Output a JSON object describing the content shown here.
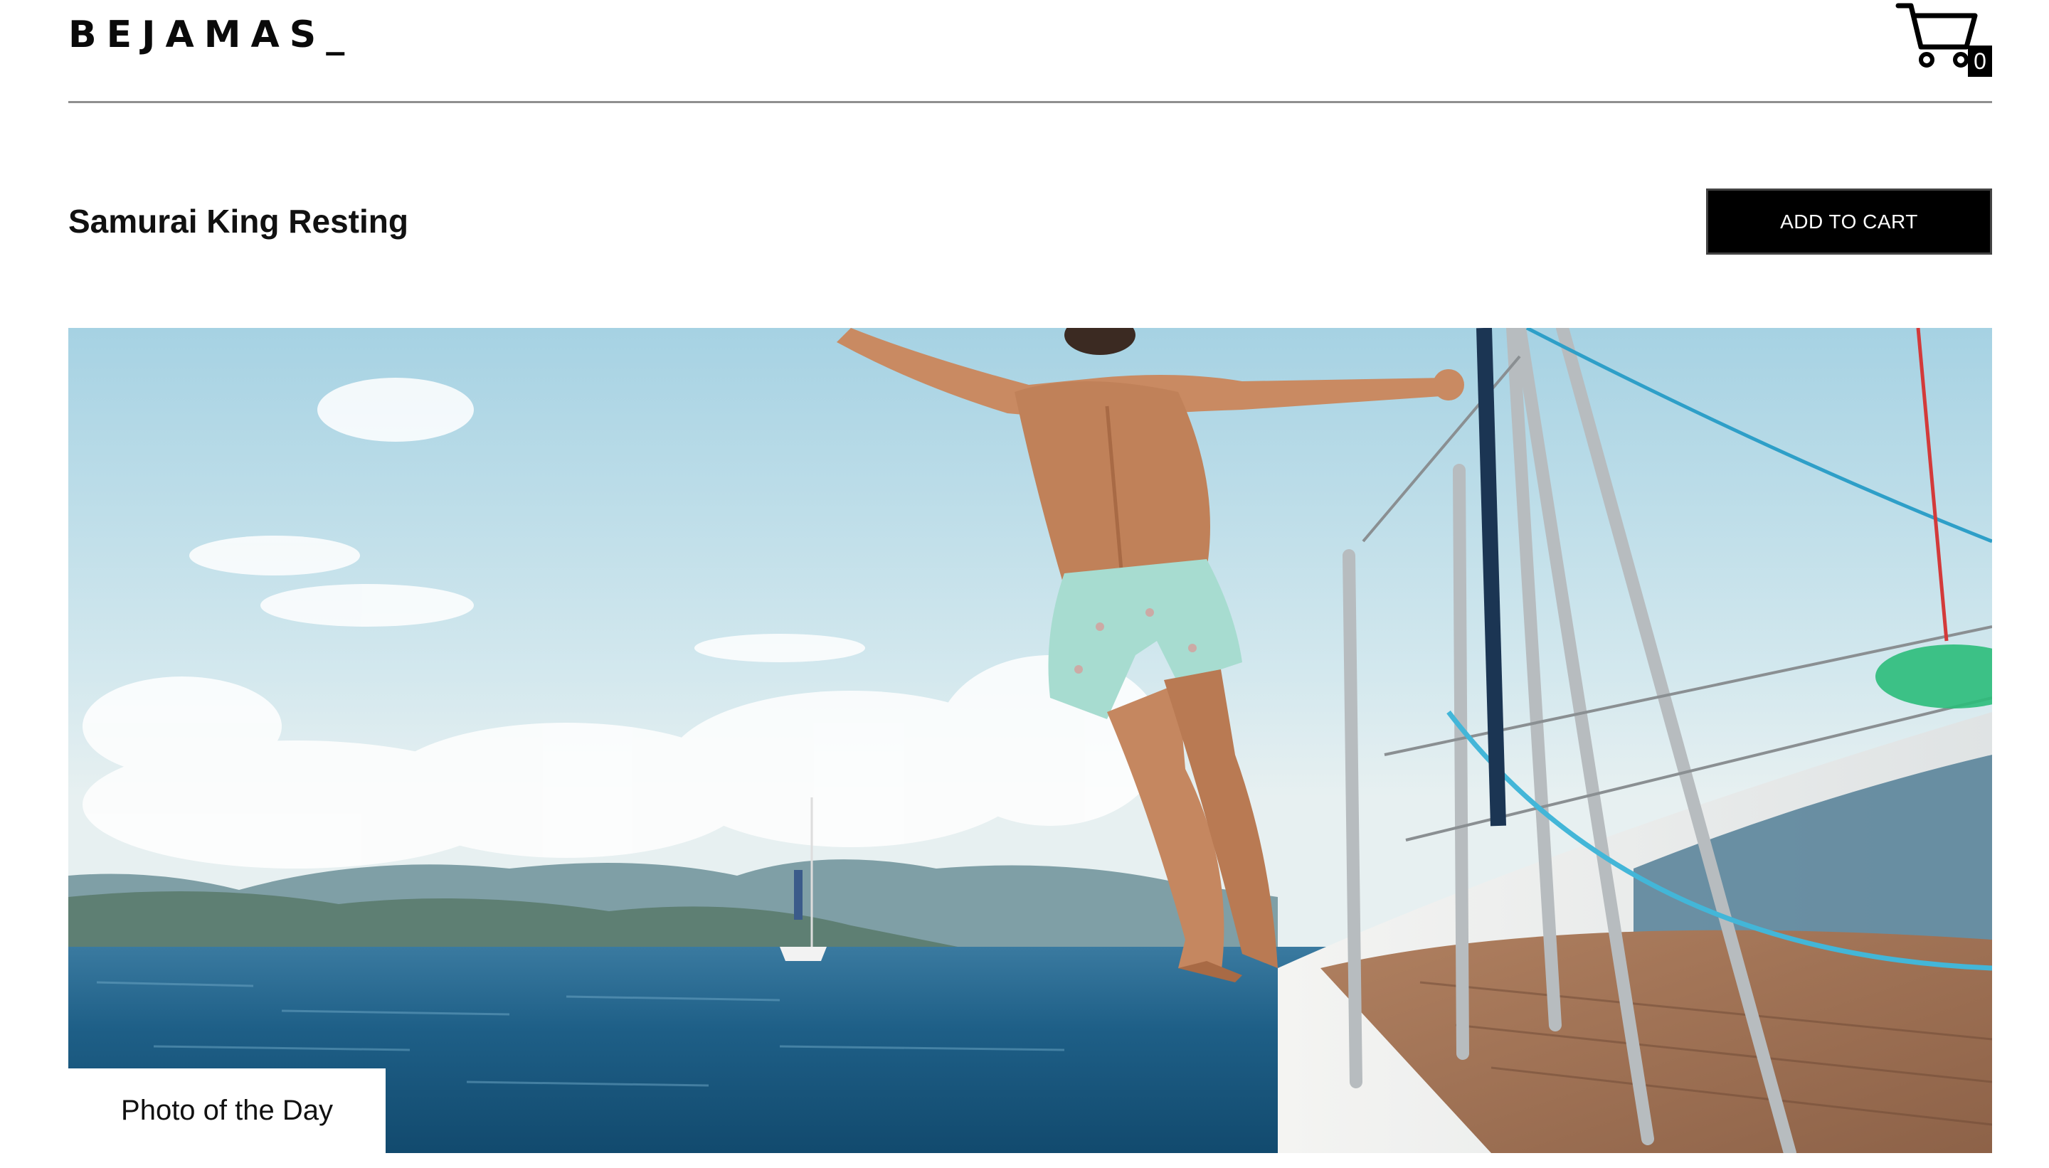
{
  "header": {
    "logo": "BEJAMAS_",
    "cart_count": "0",
    "cart_icon": "shopping-cart-icon"
  },
  "product": {
    "title": "Samurai King Resting",
    "add_to_cart_label": "ADD TO CART"
  },
  "hero": {
    "caption": "Photo of the Day"
  },
  "colors": {
    "accent": "#000000",
    "sky": "#a9d4e4",
    "sea": "#1d5a82",
    "divider": "#8f8f8f"
  }
}
